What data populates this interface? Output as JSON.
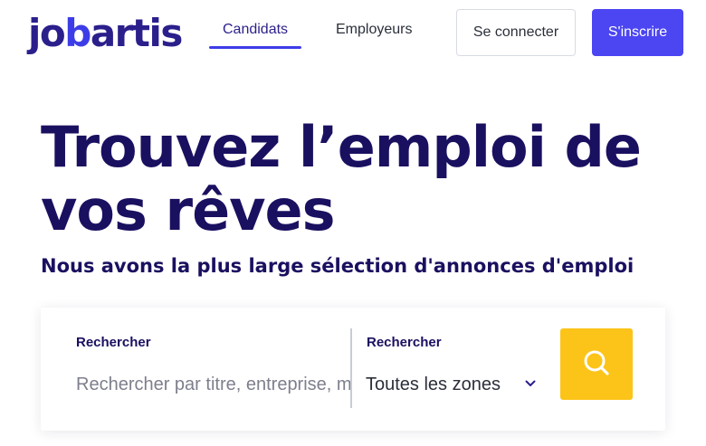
{
  "header": {
    "logo": {
      "part1": "jo",
      "part2": "b",
      "part3": "artis"
    },
    "nav": [
      {
        "label": "Candidats",
        "active": true
      },
      {
        "label": "Employeurs",
        "active": false
      }
    ],
    "login_label": "Se connecter",
    "signup_label": "S'inscrire"
  },
  "hero": {
    "title_line1": "Trouvez l’emploi de",
    "title_line2": "vos rêves",
    "subtitle": "Nous avons la plus large sélection d'annonces d'emploi"
  },
  "search": {
    "keyword_label": "Rechercher",
    "keyword_placeholder": "Rechercher par titre, entreprise, mots-clés",
    "zone_label": "Rechercher",
    "zone_value": "Toutes les zones"
  },
  "colors": {
    "primary": "#4b45f2",
    "heading": "#1a1060",
    "search_button": "#fcc419"
  },
  "icons": {
    "zone_dropdown": "chevron-down-icon",
    "search_button": "search-icon"
  }
}
